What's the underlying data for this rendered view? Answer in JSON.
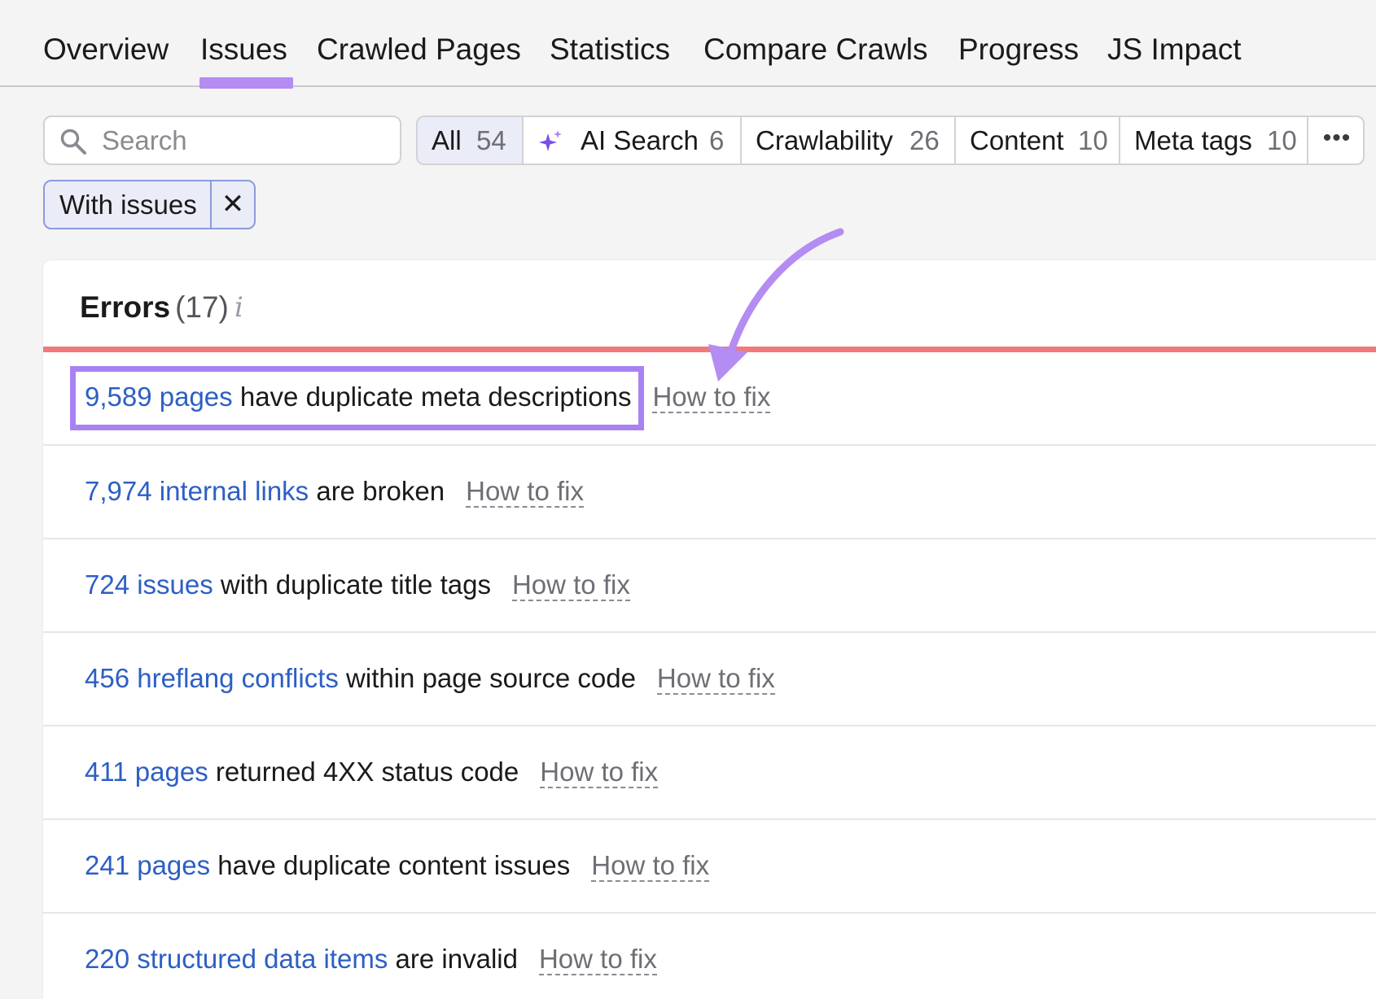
{
  "tabs": [
    {
      "label": "Overview"
    },
    {
      "label": "Issues"
    },
    {
      "label": "Crawled Pages"
    },
    {
      "label": "Statistics"
    },
    {
      "label": "Compare Crawls"
    },
    {
      "label": "Progress"
    },
    {
      "label": "JS Impact"
    }
  ],
  "active_tab": "Issues",
  "search": {
    "placeholder": "Search",
    "icon": "search-icon"
  },
  "filters": [
    {
      "label": "All",
      "count": "54",
      "active": true
    },
    {
      "label": "AI Search",
      "count": "6",
      "icon": "sparkle-icon"
    },
    {
      "label": "Crawlability",
      "count": "26"
    },
    {
      "label": "Content",
      "count": "10"
    },
    {
      "label": "Meta tags",
      "count": "10"
    }
  ],
  "more_label": "•••",
  "chip": {
    "label": "With issues",
    "close": "✕"
  },
  "errors": {
    "title": "Errors",
    "count": "(17)",
    "info": "i",
    "rows": [
      {
        "link": "9,589 pages",
        "text": " have duplicate meta descriptions",
        "fix": "How to fix"
      },
      {
        "link": "7,974 internal links",
        "text": " are broken",
        "fix": "How to fix"
      },
      {
        "link": "724 issues",
        "text": " with duplicate title tags",
        "fix": "How to fix"
      },
      {
        "link": "456 hreflang conflicts",
        "text": " within page source code",
        "fix": "How to fix"
      },
      {
        "link": "411 pages",
        "text": " returned 4XX status code",
        "fix": "How to fix"
      },
      {
        "link": "241 pages",
        "text": " have duplicate content issues",
        "fix": "How to fix"
      },
      {
        "link": "220 structured data items",
        "text": " are invalid",
        "fix": "How to fix"
      }
    ]
  },
  "colors": {
    "accent_purple": "#a882f2",
    "link_blue": "#2d5fc4",
    "error_red": "#f07a7a",
    "active_filter_bg": "#eaecf8"
  }
}
